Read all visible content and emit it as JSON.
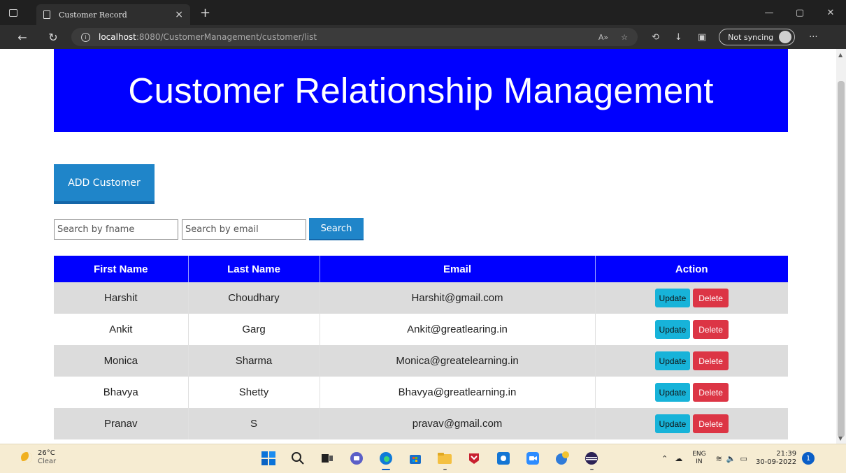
{
  "browser": {
    "tab_title": "Customer Record",
    "tab_close": "×",
    "new_tab": "+",
    "url_host": "localhost",
    "url_path": ":8080/CustomerManagement/customer/list",
    "sync_label": "Not syncing",
    "more": "···",
    "win_minimize": "—",
    "win_restore": "▢",
    "win_close": "✕"
  },
  "page": {
    "banner_title": "Customer Relationship Management",
    "add_button": "ADD Customer",
    "search_fname_placeholder": "Search by fname",
    "search_email_placeholder": "Search by email",
    "search_button": "Search"
  },
  "table": {
    "headers": [
      "First Name",
      "Last Name",
      "Email",
      "Action"
    ],
    "rows": [
      {
        "first": "Harshit",
        "last": "Choudhary",
        "email": "Harshit@gmail.com"
      },
      {
        "first": "Ankit",
        "last": "Garg",
        "email": "Ankit@greatlearing.in"
      },
      {
        "first": "Monica",
        "last": "Sharma",
        "email": "Monica@greatelearning.in"
      },
      {
        "first": "Bhavya",
        "last": "Shetty",
        "email": "Bhavya@greatlearning.in"
      },
      {
        "first": "Pranav",
        "last": "S",
        "email": "pravav@gmail.com"
      }
    ],
    "update_label": "Update",
    "delete_label": "Delete"
  },
  "taskbar": {
    "temperature": "26°C",
    "condition": "Clear",
    "lang_top": "ENG",
    "lang_bottom": "IN",
    "time": "21:39",
    "date": "30-09-2022",
    "notifications": "1"
  },
  "colors": {
    "banner": "#0000ff",
    "button_blue": "#1f85c9",
    "update": "#17b3d9",
    "delete": "#dc3545"
  }
}
